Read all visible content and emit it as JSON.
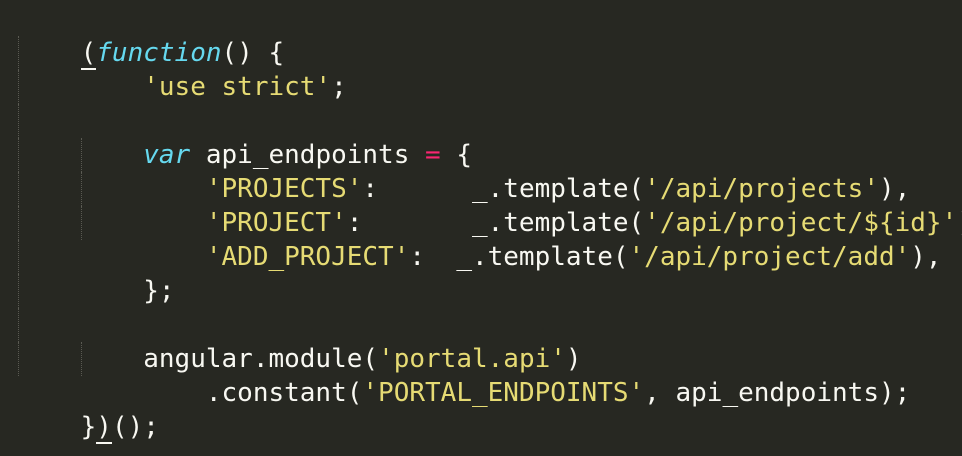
{
  "theme": {
    "background": "#272822",
    "text": "#f8f8f2",
    "keyword": "#66d9ef",
    "string": "#e6db74",
    "operator": "#f92672"
  },
  "code": {
    "l1": [
      "(",
      "function",
      "() {"
    ],
    "l2": [
      "'use strict'",
      ";"
    ],
    "l4": [
      "var",
      " api_endpoints ",
      "=",
      " {"
    ],
    "l5": [
      "'PROJECTS'",
      ":      _.template(",
      "'/api/projects'",
      "),"
    ],
    "l6": [
      "'PROJECT'",
      ":       _.template(",
      "'/api/project/${id}'",
      "),"
    ],
    "l7": [
      "'ADD_PROJECT'",
      ":  _.template(",
      "'/api/project/add'",
      "),"
    ],
    "l8": [
      "};"
    ],
    "l10": [
      "angular.module(",
      "'portal.api'",
      ")"
    ],
    "l11": [
      ".constant(",
      "'PORTAL_ENDPOINTS'",
      ", api_endpoints);"
    ],
    "l12": [
      "}",
      ")();"
    ]
  }
}
